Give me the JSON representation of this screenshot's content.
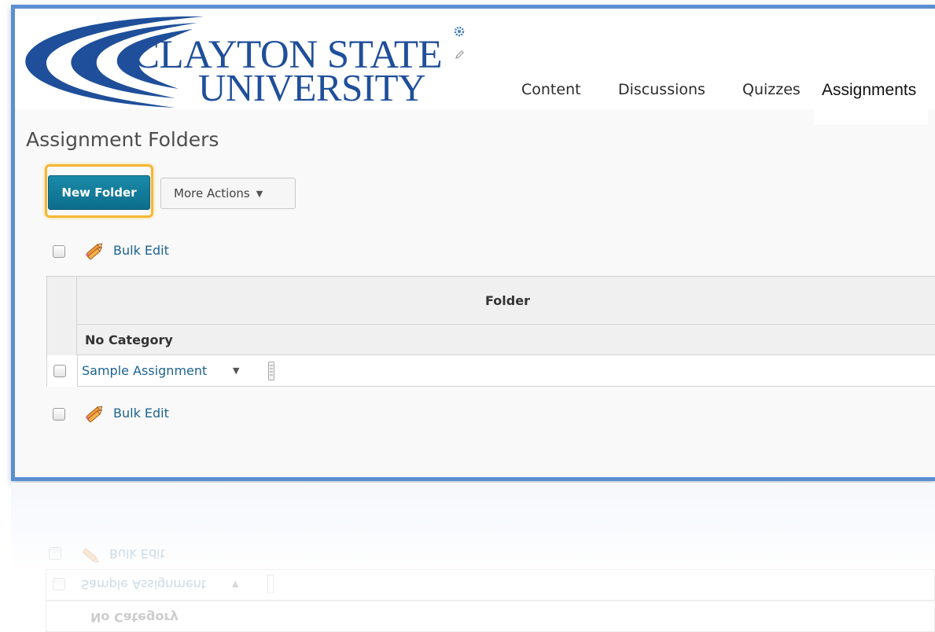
{
  "app": {
    "logo_line1": "CLAYTON STATE",
    "logo_line2": "UNIVERSITY"
  },
  "nav": {
    "items": [
      {
        "label": "Content"
      },
      {
        "label": "Discussions"
      },
      {
        "label": "Quizzes"
      },
      {
        "label": "Assignments",
        "active": true
      }
    ]
  },
  "page": {
    "title": "Assignment Folders"
  },
  "toolbar": {
    "new_folder_label": "New Folder",
    "more_actions_label": "More Actions"
  },
  "bulk": {
    "top_label": "Bulk Edit",
    "bottom_label": "Bulk Edit"
  },
  "table": {
    "header": "Folder",
    "category": "No Category",
    "rows": [
      {
        "name": "Sample Assignment"
      }
    ]
  },
  "colors": {
    "accent": "#0c6d8c",
    "link": "#1c6391",
    "focus": "#f5b731",
    "brand": "#1f4f9a",
    "frame": "#5b8fd0"
  },
  "icons": {
    "gear": "gear-icon",
    "pencil": "pencil-icon",
    "bulk_edit": "bulk-edit-pencil-icon",
    "dropdown": "chevron-down-icon",
    "drag": "drag-handle-icon"
  }
}
